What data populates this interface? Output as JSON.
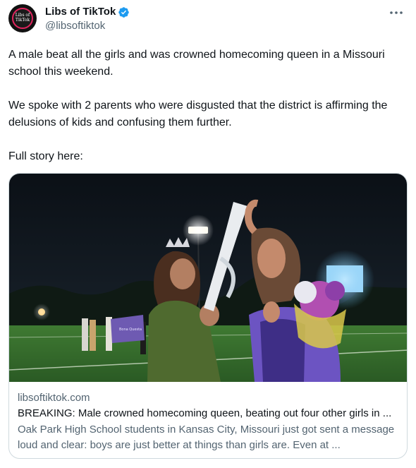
{
  "author": {
    "display_name": "Libs of TikTok",
    "handle": "@libsoftiktok",
    "avatar_text": "Libs of TikTok",
    "verified_icon": "verified-badge-icon",
    "verified_color": "#1d9bf0"
  },
  "tweet": {
    "paragraphs": [
      "A male beat all the girls and was crowned homecoming queen in a Missouri school this weekend.",
      "We spoke with 2 parents who were disgusted that the district is affirming the delusions of kids and confusing them further.",
      "Full story here:"
    ]
  },
  "link_card": {
    "domain": "libsoftiktok.com",
    "title": "BREAKING: Male crowned homecoming queen, beating out four other girls in ...",
    "description": "Oak Park High School students in Kansas City, Missouri just got sent a message loud and clear: boys are just better at things than girls are. Even at ...",
    "image_banner_text": "Bona Questa"
  },
  "colors": {
    "text_primary": "#0f1419",
    "text_secondary": "#536471",
    "border": "#cfd9de"
  }
}
